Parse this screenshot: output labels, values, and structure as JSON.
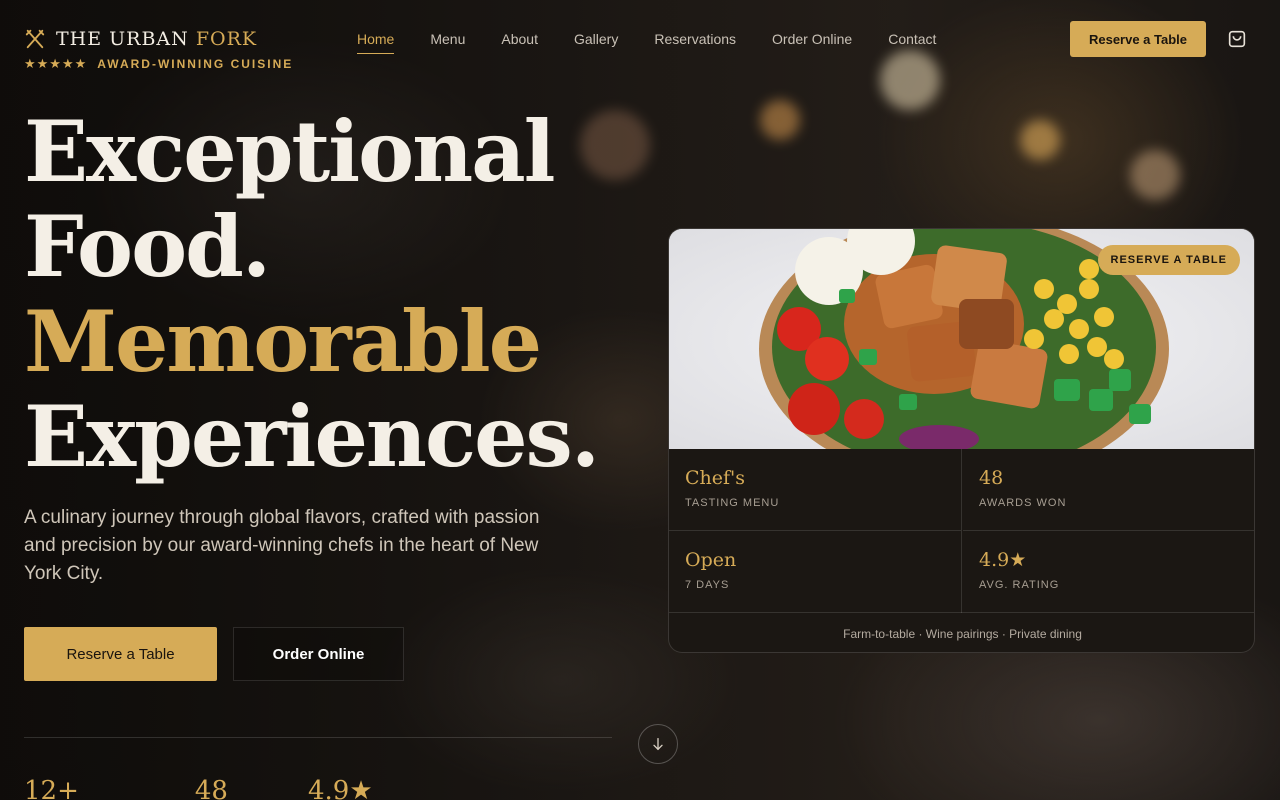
{
  "brand": {
    "name_main": "THE URBAN ",
    "name_accent": "FORK",
    "stars": "★★★★★",
    "tagline": "AWARD-WINNING CUISINE",
    "icon": "fork-knife-icon"
  },
  "nav": {
    "items": [
      {
        "label": "Home",
        "active": true
      },
      {
        "label": "Menu"
      },
      {
        "label": "About"
      },
      {
        "label": "Gallery"
      },
      {
        "label": "Reservations"
      },
      {
        "label": "Order Online"
      },
      {
        "label": "Contact"
      }
    ],
    "cta_label": "Reserve a Table",
    "cart_icon": "shopping-bag-icon"
  },
  "hero": {
    "line1": "Exceptional",
    "line2": "Food.",
    "line3": "Memorable",
    "line4": "Experiences.",
    "description": "A culinary journey through global flavors, crafted with passion and precision by our award-winning chefs in the heart of New York City.",
    "primary_button": "Reserve a Table",
    "secondary_button": "Order Online",
    "scroll_icon": "arrow-down-icon"
  },
  "bottom_stats": [
    "12+",
    "48",
    "4.9★"
  ],
  "card": {
    "badge": "RESERVE A TABLE",
    "cells": [
      {
        "value": "Chef's",
        "label": "TASTING MENU"
      },
      {
        "value": "48",
        "label": "AWARDS WON"
      },
      {
        "value": "Open",
        "label": "7 DAYS"
      },
      {
        "value": "4.9★",
        "label": "AVG. RATING"
      }
    ],
    "footer": "Farm-to-table · Wine pairings · Private dining"
  },
  "colors": {
    "accent": "#d6ab57",
    "background": "#1d1916",
    "text": "#f2ece2"
  }
}
